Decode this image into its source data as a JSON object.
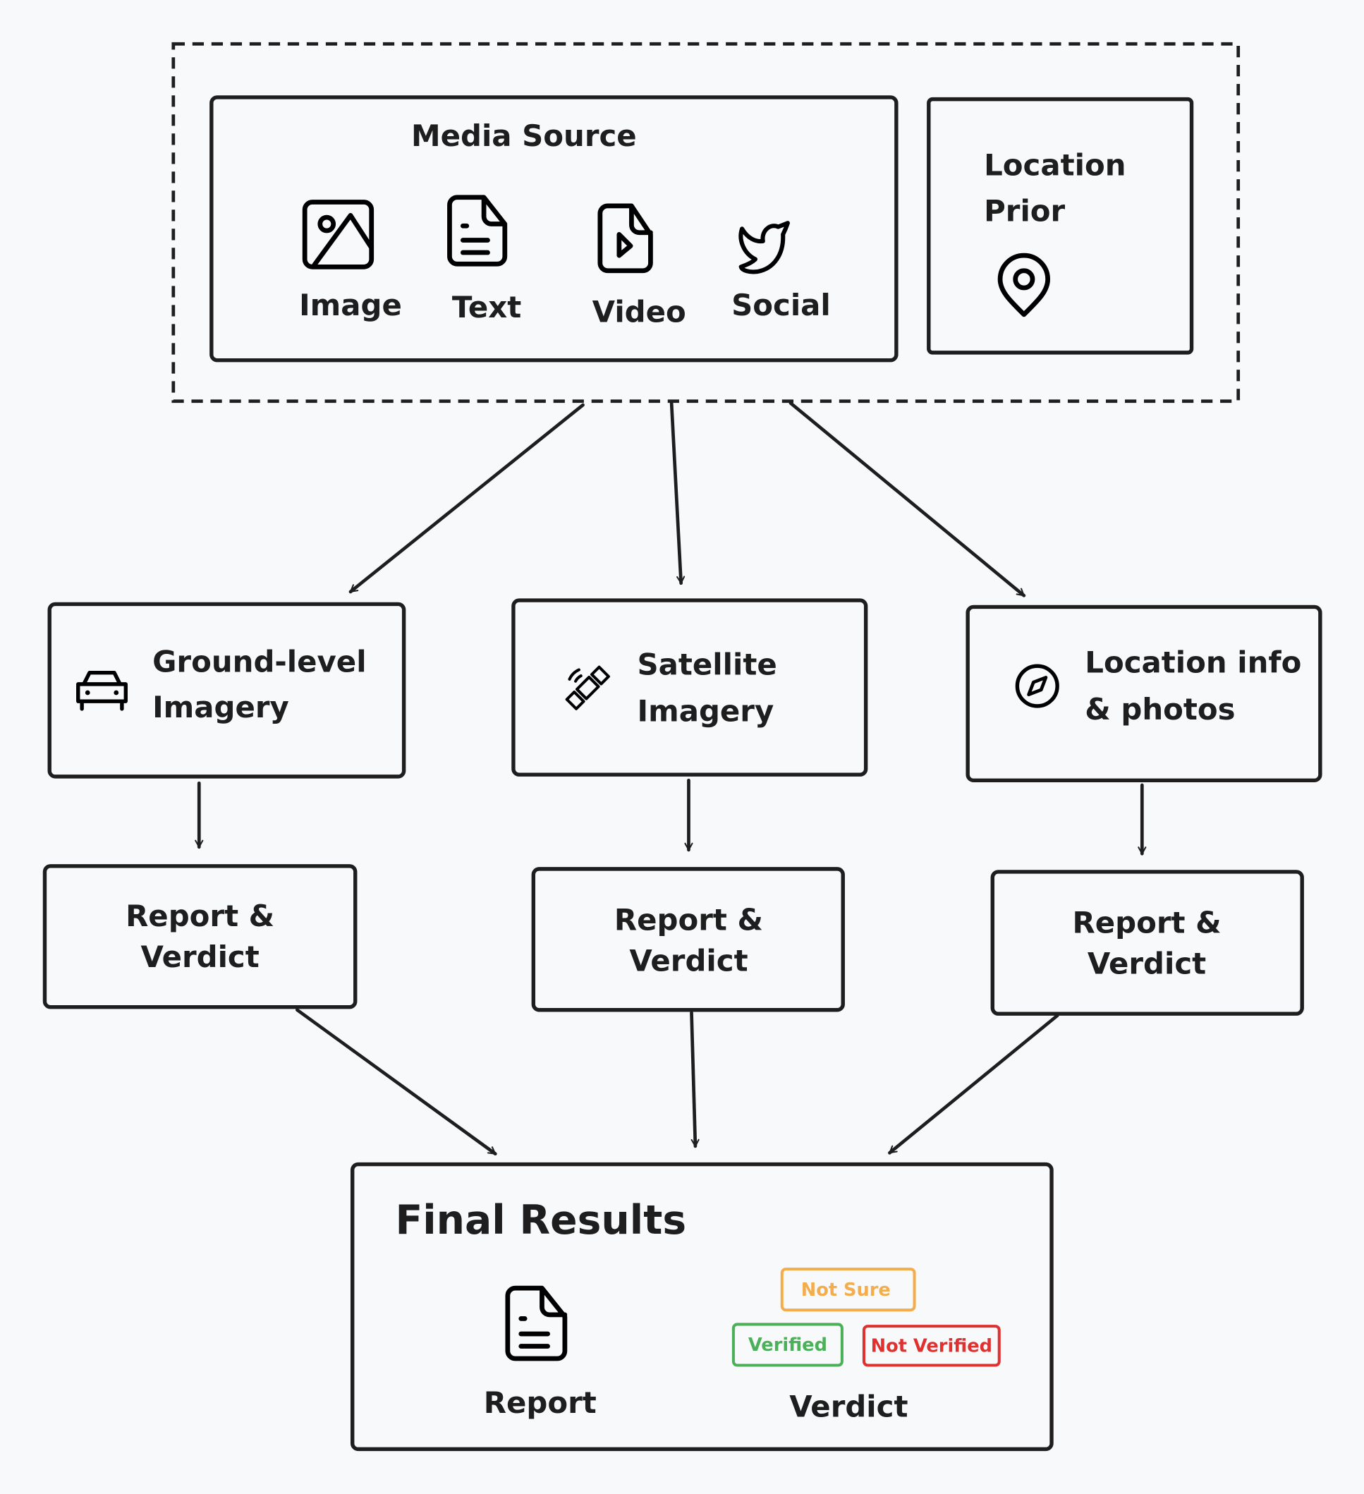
{
  "input_group": {
    "media_source": {
      "title": "Media Source",
      "items": [
        {
          "label": "Image",
          "icon": "image-icon"
        },
        {
          "label": "Text",
          "icon": "document-icon"
        },
        {
          "label": "Video",
          "icon": "video-file-icon"
        },
        {
          "label": "Social",
          "icon": "twitter-bird-icon"
        }
      ]
    },
    "location_prior": {
      "line1": "Location",
      "line2": "Prior",
      "icon": "map-pin-icon"
    }
  },
  "pipelines": [
    {
      "line1": "Ground-level",
      "line2": "Imagery",
      "icon": "car-icon",
      "output": {
        "line1": "Report &",
        "line2": "Verdict"
      }
    },
    {
      "line1": "Satellite",
      "line2": "Imagery",
      "icon": "satellite-icon",
      "output": {
        "line1": "Report &",
        "line2": "Verdict"
      }
    },
    {
      "line1": "Location info",
      "line2": "& photos",
      "icon": "compass-icon",
      "output": {
        "line1": "Report &",
        "line2": "Verdict"
      }
    }
  ],
  "final_results": {
    "title": "Final Results",
    "report_label": "Report",
    "verdict_label": "Verdict",
    "badges": [
      {
        "label": "Not Sure",
        "color": "#f4ad4d"
      },
      {
        "label": "Verified",
        "color": "#4caf5a"
      },
      {
        "label": "Not Verified",
        "color": "#e03131"
      }
    ]
  }
}
